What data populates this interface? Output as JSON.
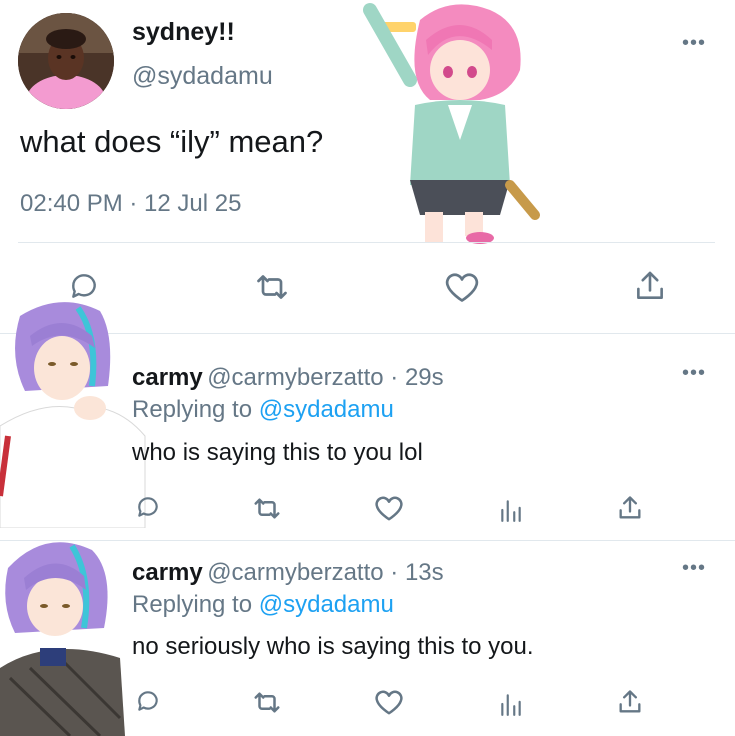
{
  "colors": {
    "accent": "#1da1f2",
    "muted": "#657786",
    "divider": "#e1e8ed"
  },
  "main_tweet": {
    "display_name": "sydney!!",
    "handle": "@sydadamu",
    "text": "what does “ily” mean?",
    "timestamp": "02:40 PM · 12 Jul 25",
    "more": "•••",
    "actions": [
      "reply-icon",
      "retweet-icon",
      "like-icon",
      "share-icon"
    ]
  },
  "replies": [
    {
      "display_name": "carmy",
      "handle": "@carmyberzatto",
      "time": " · 29s",
      "replying_prefix": "Replying to ",
      "replying_to": "@sydadamu",
      "text": "who is saying this to you lol",
      "more": "•••"
    },
    {
      "display_name": "carmy",
      "handle": "@carmyberzatto",
      "time": " · 13s",
      "replying_prefix": "Replying to ",
      "replying_to": "@sydadamu",
      "text": "no seriously who is saying this to you.",
      "more": "•••"
    }
  ]
}
